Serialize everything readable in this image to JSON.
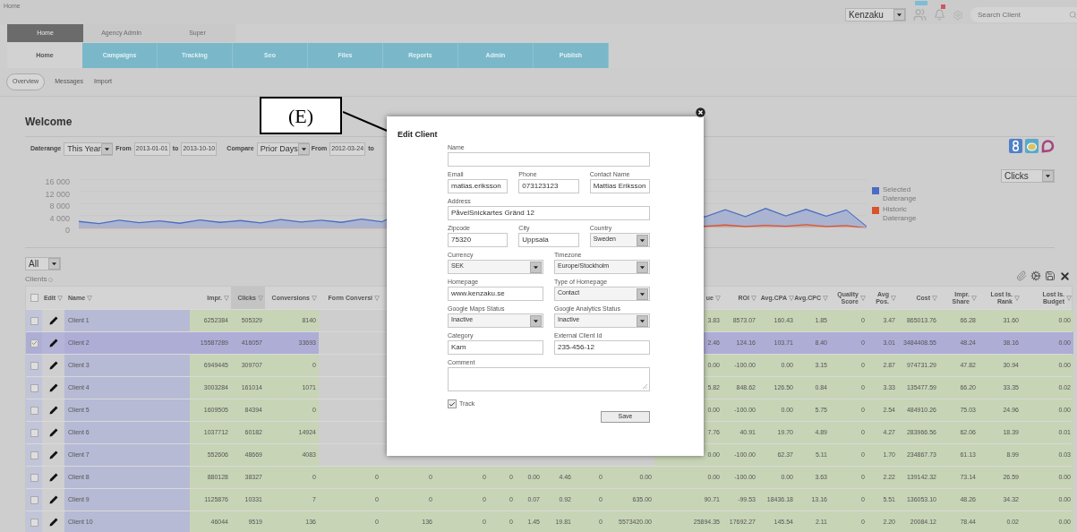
{
  "breadcrumb": "Home",
  "header": {
    "account_select": "Kenzaku",
    "search": {
      "placeholder": "Search Client"
    }
  },
  "top_tabs": [
    {
      "label": "Home",
      "selected": true
    },
    {
      "label": "Agency Admin",
      "selected": false
    },
    {
      "label": "Super",
      "selected": false
    }
  ],
  "nav": [
    {
      "label": "Home",
      "selected": true
    },
    {
      "label": "Campaigns",
      "selected": false
    },
    {
      "label": "Tracking",
      "selected": false
    },
    {
      "label": "Seo",
      "selected": false
    },
    {
      "label": "Files",
      "selected": false
    },
    {
      "label": "Reports",
      "selected": false
    },
    {
      "label": "Admin",
      "selected": false
    },
    {
      "label": "Publish",
      "selected": false
    }
  ],
  "subnav": [
    {
      "label": "Overview",
      "selected": true
    },
    {
      "label": "Messages",
      "selected": false
    },
    {
      "label": "Import",
      "selected": false
    }
  ],
  "page_title": "Welcome",
  "filters": {
    "daterange_label": "Daterange",
    "daterange": "This Year",
    "from_label": "From",
    "from": "2013-01-01",
    "to_label": "to",
    "to": "2013-10-10",
    "compare_label": "Compare",
    "compare": "Prior Days",
    "compare_from_label": "From",
    "compare_from": "2012-03-24",
    "compare_to_label": "to"
  },
  "metric_select": "Clicks",
  "chart": {
    "y_labels": [
      "16 000",
      "12 000",
      "8 000",
      "4 000",
      "0"
    ],
    "legend": [
      {
        "label": "Selected Daterange",
        "color": "#4a6cc4"
      },
      {
        "label": "Historic Daterange",
        "color": "#d9532c"
      }
    ]
  },
  "filter_select": "All",
  "clients_label": "Clients",
  "table": {
    "select_all_checked": false,
    "columns": [
      {
        "label": "Impr.",
        "sorted": false
      },
      {
        "label": "Clicks",
        "sorted": true
      },
      {
        "label": "Conversions",
        "sorted": false
      },
      {
        "label": "Form Conversi",
        "sorted": false
      },
      null,
      null,
      null,
      null,
      null,
      null,
      null,
      {
        "label": "ue",
        "sorted": false
      },
      {
        "label": "ROI",
        "sorted": false
      },
      {
        "label": "Avg.CPA",
        "sorted": false
      },
      {
        "label": "Avg.CPC",
        "sorted": false
      },
      {
        "label": "Quality Score",
        "sorted": false
      },
      {
        "label": "Avg Pos.",
        "sorted": false
      },
      {
        "label": "Cost",
        "sorted": false
      },
      {
        "label": "Impr. Share",
        "sorted": false
      },
      {
        "label": "Lost Is. Rank",
        "sorted": false
      },
      {
        "label": "Lost Is. Budget",
        "sorted": false
      }
    ],
    "edit_header": "Edit",
    "name_header": "Name",
    "rows": [
      {
        "name": "Client 1",
        "selected": false,
        "cells": [
          "6252384",
          "505329",
          "8140",
          null,
          null,
          null,
          null,
          null,
          null,
          null,
          null,
          "3.83",
          "8573.07",
          "160.43",
          "1.85",
          "0",
          "3.47",
          "865013.76",
          "66.28",
          "31.60",
          "0.00"
        ]
      },
      {
        "name": "Client 2",
        "selected": true,
        "cells": [
          "15587289",
          "416057",
          "33693",
          null,
          null,
          null,
          null,
          null,
          null,
          null,
          null,
          "2.46",
          "124.16",
          "103.71",
          "8.40",
          "0",
          "3.01",
          "3484408.55",
          "48.24",
          "38.16",
          "0.00"
        ]
      },
      {
        "name": "Client 3",
        "selected": false,
        "cells": [
          "6949445",
          "309707",
          "0",
          null,
          null,
          null,
          null,
          null,
          null,
          null,
          null,
          "0.00",
          "-100.00",
          "0.00",
          "3.15",
          "0",
          "2.87",
          "974731.29",
          "47.82",
          "30.94",
          "0.00"
        ]
      },
      {
        "name": "Client 4",
        "selected": false,
        "cells": [
          "3003284",
          "161014",
          "1071",
          null,
          null,
          null,
          null,
          null,
          null,
          null,
          null,
          "5.82",
          "848.62",
          "126.50",
          "0.84",
          "0",
          "3.33",
          "135477.59",
          "66.20",
          "33.35",
          "0.02"
        ]
      },
      {
        "name": "Client 5",
        "selected": false,
        "cells": [
          "1609505",
          "84394",
          "0",
          null,
          null,
          null,
          null,
          null,
          null,
          null,
          null,
          "0.00",
          "-100.00",
          "0.00",
          "5.75",
          "0",
          "2.54",
          "484910.26",
          "75.03",
          "24.96",
          "0.00"
        ]
      },
      {
        "name": "Client 6",
        "selected": false,
        "cells": [
          "1037712",
          "60182",
          "14924",
          null,
          null,
          null,
          null,
          null,
          null,
          null,
          null,
          "7.76",
          "40.91",
          "19.70",
          "4.89",
          "0",
          "4.27",
          "283966.56",
          "62.06",
          "18.39",
          "0.01"
        ]
      },
      {
        "name": "Client 7",
        "selected": false,
        "cells": [
          "552606",
          "48669",
          "4083",
          null,
          null,
          null,
          null,
          null,
          null,
          null,
          null,
          "0.00",
          "-100.00",
          "62.37",
          "5.11",
          "0",
          "1.70",
          "234867.73",
          "61.13",
          "8.99",
          "0.03"
        ]
      },
      {
        "name": "Client 8",
        "selected": false,
        "cells": [
          "880128",
          "38327",
          "0",
          "0",
          "0",
          "0",
          "0",
          "0.00",
          "4.46",
          "0",
          "0.00",
          "0.00",
          "-100.00",
          "0.00",
          "3.63",
          "0",
          "2.22",
          "139142.32",
          "73.14",
          "26.59",
          "0.00"
        ]
      },
      {
        "name": "Client 9",
        "selected": false,
        "cells": [
          "1125876",
          "10331",
          "7",
          "0",
          "0",
          "0",
          "0",
          "0.07",
          "0.92",
          "0",
          "635.00",
          "90.71",
          "-99.53",
          "18436.18",
          "13.16",
          "0",
          "5.51",
          "136053.10",
          "48.26",
          "34.32",
          "0.00"
        ]
      },
      {
        "name": "Client 10",
        "selected": false,
        "cells": [
          "46044",
          "9519",
          "136",
          "0",
          "136",
          "0",
          "0",
          "1.45",
          "19.81",
          "0",
          "5573420.00",
          "25894.35",
          "17692.27",
          "145.54",
          "2.11",
          "0",
          "2.20",
          "20084.12",
          "78.44",
          "0.02",
          "0.00"
        ]
      }
    ]
  },
  "modal": {
    "title": "Edit Client",
    "rows": [
      [
        {
          "label": "Name",
          "kind": "text"
        }
      ],
      [
        {
          "label": "Email",
          "kind": "text",
          "value": "matias.eriksson"
        },
        {
          "label": "Phone",
          "kind": "text",
          "value": "073123123"
        },
        {
          "label": "Contact Name",
          "kind": "text",
          "value": "Mattias Eriksson"
        }
      ],
      [
        {
          "label": "Address",
          "kind": "text",
          "value": "PåvelSnickartes Gränd 12"
        }
      ],
      [
        {
          "label": "Zipcode",
          "kind": "text",
          "value": "75320"
        },
        {
          "label": "City",
          "kind": "text",
          "value": "Uppsala"
        },
        {
          "label": "Country",
          "kind": "select",
          "value": "Sweden"
        }
      ],
      [
        {
          "label": "Currency",
          "kind": "select",
          "value": "SEK"
        },
        {
          "label": "Timezone",
          "kind": "select",
          "value": "Europe/Stockholm"
        }
      ],
      [
        {
          "label": "Homepage",
          "kind": "text",
          "value": "www.kenzaku.se"
        },
        {
          "label": "Type of Homepage",
          "kind": "select",
          "value": "Contact"
        }
      ],
      [
        {
          "label": "Google Maps Status",
          "kind": "select",
          "value": "Inactive"
        },
        {
          "label": "Google Analytics Status",
          "kind": "select",
          "value": "Inactive"
        }
      ],
      [
        {
          "label": "Category",
          "kind": "text",
          "value": "Kam"
        },
        {
          "label": "External Client Id",
          "kind": "text",
          "value": "235-456-12"
        }
      ],
      [
        {
          "label": "Comment",
          "kind": "textarea"
        }
      ]
    ],
    "track": {
      "label": "Track",
      "checked": true
    },
    "save": "Save"
  },
  "callout": "(E)"
}
